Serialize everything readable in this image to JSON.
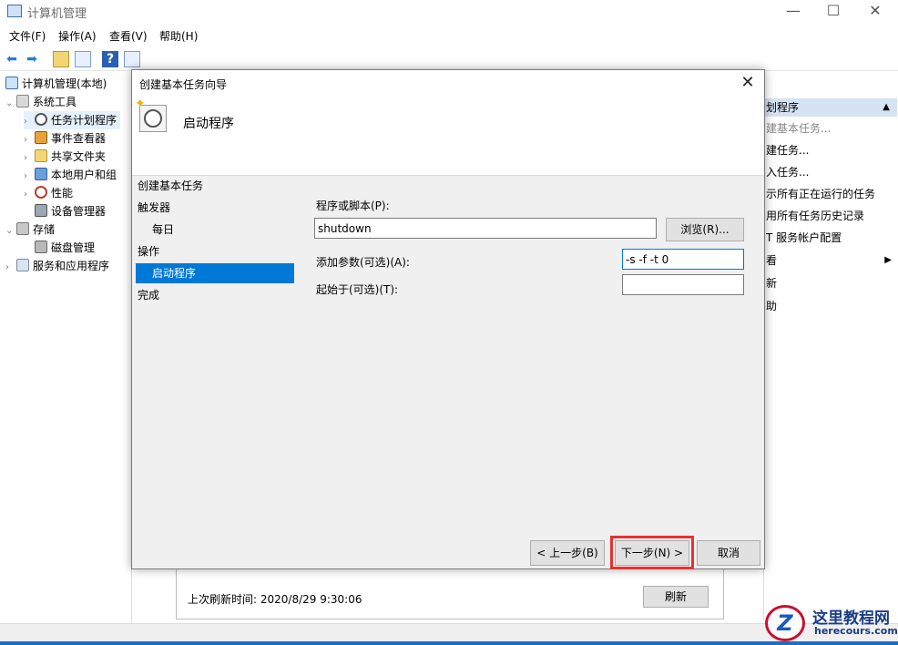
{
  "window": {
    "title": "计算机管理",
    "minimize": "—",
    "maximize": "☐",
    "close": "✕"
  },
  "menu": [
    "文件(F)",
    "操作(A)",
    "查看(V)",
    "帮助(H)"
  ],
  "toolbar": {
    "back": "⬅",
    "forward": "➡",
    "help": "?"
  },
  "tree": {
    "root": "计算机管理(本地)",
    "system_tools": "系统工具",
    "task_scheduler": "任务计划程序",
    "event_viewer": "事件查看器",
    "shared_folders": "共享文件夹",
    "local_users": "本地用户和组",
    "performance": "性能",
    "device_manager": "设备管理器",
    "storage": "存储",
    "disk_management": "磁盘管理",
    "services_apps": "服务和应用程序"
  },
  "actions": {
    "header": "划程序",
    "items": [
      "建基本任务...",
      "建任务...",
      "入任务...",
      "示所有正在运行的任务",
      "用所有任务历史记录",
      "T 服务帐户配置",
      "看",
      "新",
      "助"
    ]
  },
  "status": {
    "last_refresh": "上次刷新时间: 2020/8/29 9:30:06",
    "refresh_button": "刷新"
  },
  "dialog": {
    "title": "创建基本任务向导",
    "heading": "启动程序",
    "steps": {
      "create": "创建基本任务",
      "trigger": "触发器",
      "daily": "每日",
      "action": "操作",
      "start_program": "启动程序",
      "finish": "完成"
    },
    "form": {
      "program_label": "程序或脚本(P):",
      "program_value": "shutdown",
      "browse": "浏览(R)...",
      "args_label": "添加参数(可选)(A):",
      "args_value": "-s -f -t 0",
      "start_in_label": "起始于(可选)(T):",
      "start_in_value": ""
    },
    "buttons": {
      "back": "< 上一步(B)",
      "next": "下一步(N) >",
      "cancel": "取消"
    },
    "highlight_color": "#e8312f"
  },
  "watermark": {
    "logo_letter": "Z",
    "line1": "这里教程网",
    "line2": "herecours.com"
  }
}
